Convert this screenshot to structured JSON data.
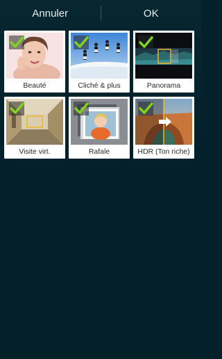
{
  "header": {
    "cancel_label": "Annuler",
    "ok_label": "OK"
  },
  "modes": [
    {
      "label": "Beauté",
      "checked": true,
      "icon": "beauty-face"
    },
    {
      "label": "Cliché & plus",
      "checked": true,
      "icon": "burst-snowboarders"
    },
    {
      "label": "Panorama",
      "checked": true,
      "icon": "panorama-landscape"
    },
    {
      "label": "Visite virt.",
      "checked": true,
      "icon": "virtual-tour-hallway"
    },
    {
      "label": "Rafale",
      "checked": true,
      "icon": "photo-stack-child"
    },
    {
      "label": "HDR (Ton riche)",
      "checked": true,
      "icon": "hdr-canyon"
    }
  ],
  "colors": {
    "background": "#04202a",
    "check_green": "#7ed321",
    "text_light": "#e9eef0"
  }
}
